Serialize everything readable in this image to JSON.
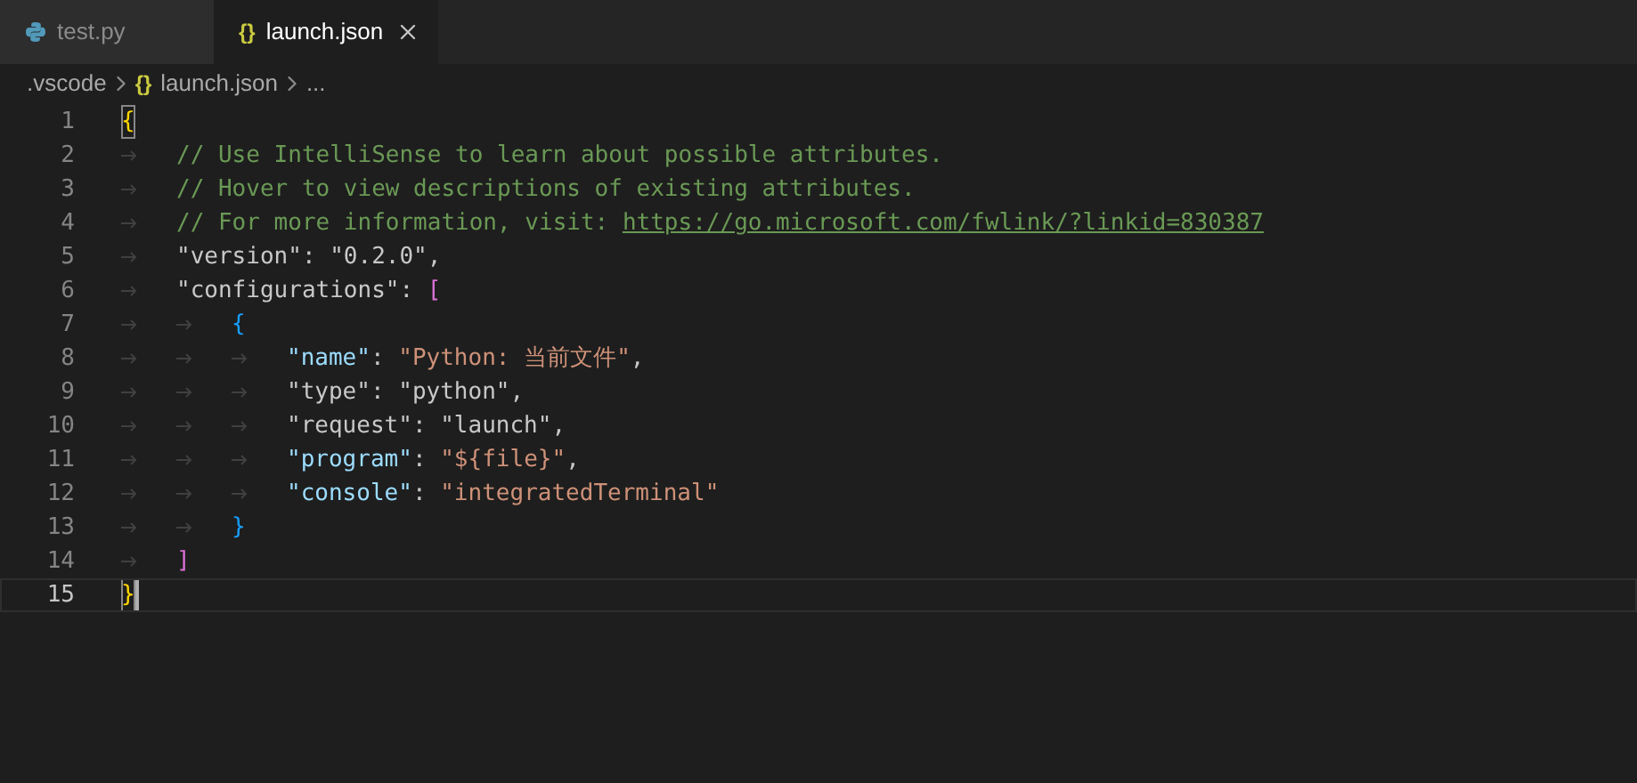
{
  "tabs": [
    {
      "label": "test.py",
      "selected": false,
      "kind": "python"
    },
    {
      "label": "launch.json",
      "selected": true,
      "kind": "braces",
      "icon_text": "{}"
    }
  ],
  "breadcrumb": [
    {
      "label": ".vscode"
    },
    {
      "label": "launch.json",
      "icon_text": "{}"
    },
    {
      "label": "..."
    }
  ],
  "lines": [
    {
      "number": "1",
      "current": false,
      "tokens": [
        {
          "kind": "brace-yellow",
          "text": "{",
          "matched": true
        }
      ]
    },
    {
      "number": "2",
      "current": false,
      "tokens": [
        {
          "kind": "tab"
        },
        {
          "kind": "comment",
          "text": "// Use IntelliSense to learn about possible attributes."
        }
      ]
    },
    {
      "number": "3",
      "current": false,
      "tokens": [
        {
          "kind": "tab"
        },
        {
          "kind": "comment",
          "text": "// Hover to view descriptions of existing attributes."
        }
      ]
    },
    {
      "number": "4",
      "current": false,
      "tokens": [
        {
          "kind": "tab"
        },
        {
          "kind": "comment",
          "text": "// For more information, visit: "
        },
        {
          "kind": "link",
          "text": "https://go.microsoft.com/fwlink/?linkid=830387"
        }
      ]
    },
    {
      "number": "5",
      "current": false,
      "tokens": [
        {
          "kind": "tab"
        },
        {
          "kind": "plain",
          "text": "\"version\": \"0.2.0\","
        }
      ]
    },
    {
      "number": "6",
      "current": false,
      "tokens": [
        {
          "kind": "tab"
        },
        {
          "kind": "plain",
          "text": "\"configurations\": "
        },
        {
          "kind": "brace-pink",
          "text": "["
        }
      ]
    },
    {
      "number": "7",
      "current": false,
      "tokens": [
        {
          "kind": "tab"
        },
        {
          "kind": "tab"
        },
        {
          "kind": "brace-blue",
          "text": "{"
        }
      ]
    },
    {
      "number": "8",
      "current": false,
      "tokens": [
        {
          "kind": "tab"
        },
        {
          "kind": "tab"
        },
        {
          "kind": "tab"
        },
        {
          "kind": "key",
          "text": "\"name\""
        },
        {
          "kind": "plain",
          "text": ": "
        },
        {
          "kind": "string",
          "text": "\"Python: 当前文件\""
        },
        {
          "kind": "plain",
          "text": ","
        }
      ]
    },
    {
      "number": "9",
      "current": false,
      "tokens": [
        {
          "kind": "tab"
        },
        {
          "kind": "tab"
        },
        {
          "kind": "tab"
        },
        {
          "kind": "plain",
          "text": "\"type\": \"python\","
        }
      ]
    },
    {
      "number": "10",
      "current": false,
      "tokens": [
        {
          "kind": "tab"
        },
        {
          "kind": "tab"
        },
        {
          "kind": "tab"
        },
        {
          "kind": "plain",
          "text": "\"request\": \"launch\","
        }
      ]
    },
    {
      "number": "11",
      "current": false,
      "tokens": [
        {
          "kind": "tab"
        },
        {
          "kind": "tab"
        },
        {
          "kind": "tab"
        },
        {
          "kind": "key",
          "text": "\"program\""
        },
        {
          "kind": "plain",
          "text": ": "
        },
        {
          "kind": "string",
          "text": "\"${file}\""
        },
        {
          "kind": "plain",
          "text": ","
        }
      ]
    },
    {
      "number": "12",
      "current": false,
      "tokens": [
        {
          "kind": "tab"
        },
        {
          "kind": "tab"
        },
        {
          "kind": "tab"
        },
        {
          "kind": "key",
          "text": "\"console\""
        },
        {
          "kind": "plain",
          "text": ": "
        },
        {
          "kind": "string",
          "text": "\"integratedTerminal\""
        }
      ]
    },
    {
      "number": "13",
      "current": false,
      "tokens": [
        {
          "kind": "tab"
        },
        {
          "kind": "tab"
        },
        {
          "kind": "brace-blue",
          "text": "}"
        }
      ]
    },
    {
      "number": "14",
      "current": false,
      "tokens": [
        {
          "kind": "tab"
        },
        {
          "kind": "brace-pink",
          "text": "]"
        }
      ]
    },
    {
      "number": "15",
      "current": true,
      "tokens": [
        {
          "kind": "brace-yellow",
          "text": "}",
          "matched": true
        }
      ]
    }
  ]
}
